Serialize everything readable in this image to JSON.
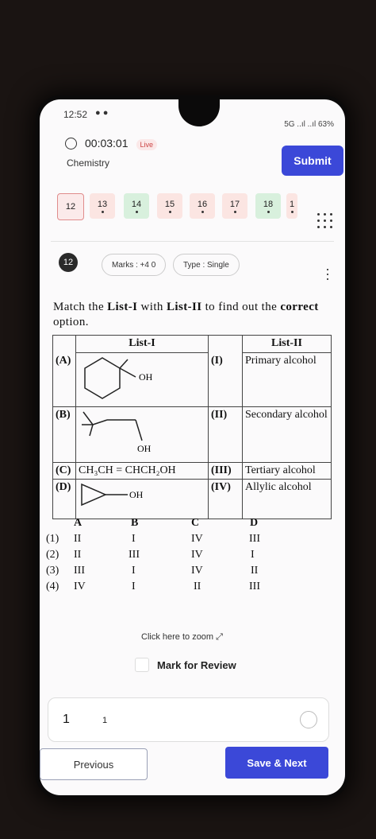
{
  "status": {
    "time": "12:52",
    "right": "5G ..ıl ..ıl 63%"
  },
  "header": {
    "timer": "00:03:01",
    "live": "Live",
    "subject": "Chemistry",
    "submit": "Submit"
  },
  "question_nav": [
    {
      "n": "12",
      "state": "current"
    },
    {
      "n": "13",
      "state": "notans"
    },
    {
      "n": "14",
      "state": "ans"
    },
    {
      "n": "15",
      "state": "notans"
    },
    {
      "n": "16",
      "state": "notans"
    },
    {
      "n": "17",
      "state": "notans"
    },
    {
      "n": "18",
      "state": "ans"
    },
    {
      "n": "1",
      "state": "notans"
    }
  ],
  "question": {
    "number": "12",
    "marks": "Marks : +4 0",
    "type": "Type : Single",
    "text_prefix": "Match the ",
    "list1": "List-I",
    "text_mid": " with ",
    "list2": "List-II",
    "text_mid2": " to find out the ",
    "correct": "correct",
    "text_suffix": " option."
  },
  "table": {
    "head1": "List-I",
    "head2": "List-II",
    "rows": [
      {
        "a": "(A)",
        "b_label": "OH",
        "c": "(I)",
        "d": "Primary alcohol"
      },
      {
        "a": "(B)",
        "b_label": "OH",
        "c": "(II)",
        "d": "Secondary alcohol"
      },
      {
        "a": "(C)",
        "b_label": "CH₃CH = CHCH₂OH",
        "c": "(III)",
        "d": "Tertiary alcohol"
      },
      {
        "a": "(D)",
        "b_label": "OH",
        "c": "(IV)",
        "d": "Allylic alcohol"
      }
    ]
  },
  "options": {
    "header": [
      "A",
      "B",
      "C",
      "D"
    ],
    "rows": [
      {
        "n": "(1)",
        "v": [
          "II",
          "I",
          "IV",
          "III"
        ]
      },
      {
        "n": "(2)",
        "v": [
          "II",
          "III",
          "IV",
          "I"
        ]
      },
      {
        "n": "(3)",
        "v": [
          "III",
          "I",
          "IV",
          "II"
        ]
      },
      {
        "n": "(4)",
        "v": [
          "IV",
          "I",
          "II",
          "III"
        ]
      }
    ]
  },
  "zoom": "Click here to zoom",
  "review": "Mark for Review",
  "answer": {
    "num": "1",
    "text": "1"
  },
  "buttons": {
    "previous": "Previous",
    "next": "Save & Next"
  }
}
